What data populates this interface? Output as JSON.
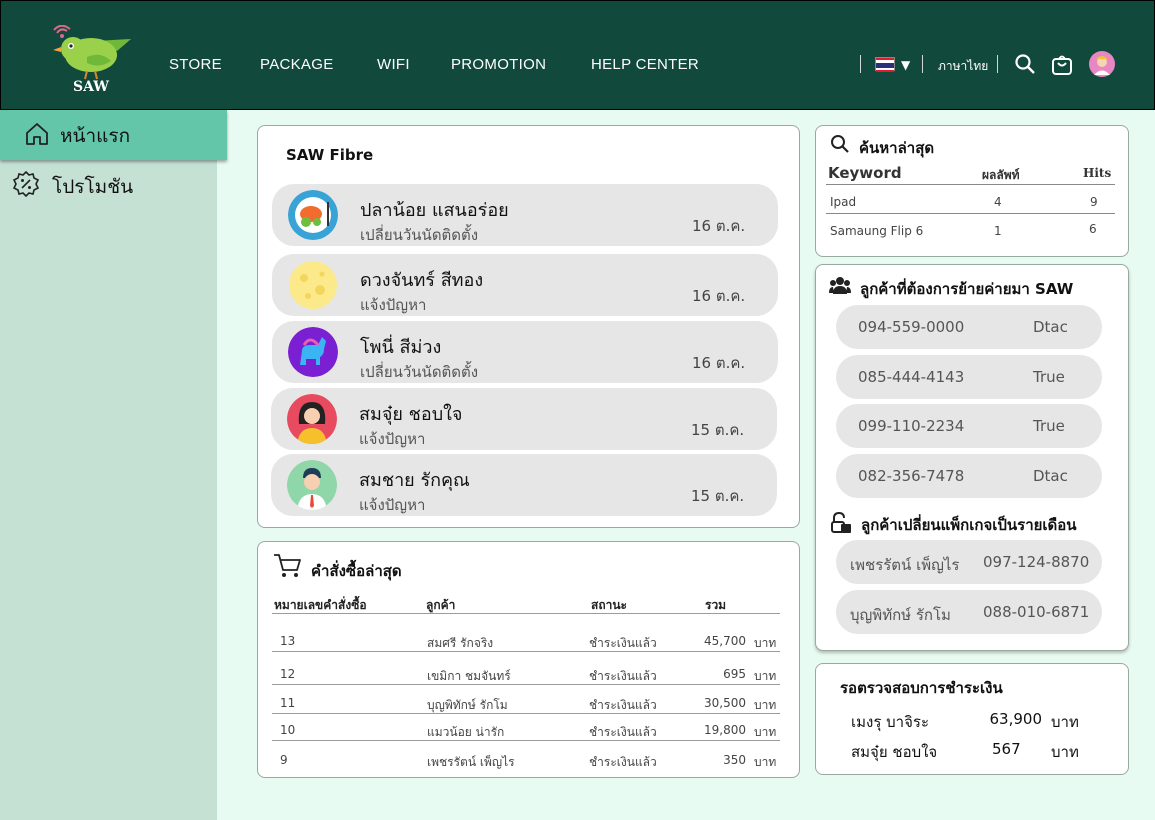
{
  "brand": {
    "name": "SAW"
  },
  "nav": [
    {
      "label": "STORE"
    },
    {
      "label": "PACKAGE"
    },
    {
      "label": "WIFI"
    },
    {
      "label": "PROMOTION"
    },
    {
      "label": "HELP CENTER"
    }
  ],
  "topbar": {
    "language": "ภาษาไทย",
    "icons": [
      "thailand-flag-icon",
      "search-icon",
      "cart-icon",
      "user-avatar"
    ]
  },
  "sidebar": {
    "items": [
      {
        "label": "หน้าแรก",
        "icon": "home-icon",
        "active": true
      },
      {
        "label": "โปรโมชัน",
        "icon": "discount-badge-icon",
        "active": false
      }
    ]
  },
  "colors": {
    "header": "#114a3d",
    "sidebar": "#c5e1d4",
    "sidebar_active": "#63c6a8",
    "background": "#e8fbf2",
    "pill": "#e6e6e6"
  },
  "feed": {
    "title": "SAW Fibre",
    "items": [
      {
        "name": "ปลาน้อย แสนอร่อย",
        "status": "เปลี่ยนวันนัดติดตั้ง",
        "date": "16 ต.ค.",
        "avatar": "food-plate-avatar"
      },
      {
        "name": "ดวงจันทร์ สีทอง",
        "status": "แจ้งปัญหา",
        "date": "16 ต.ค.",
        "avatar": "moon-avatar"
      },
      {
        "name": "โพนี่ สีม่วง",
        "status": "เปลี่ยนวันนัดติดตั้ง",
        "date": "16 ต.ค.",
        "avatar": "pony-avatar"
      },
      {
        "name": "สมจุ๋ย ชอบใจ",
        "status": "แจ้งปัญหา",
        "date": "15 ต.ค.",
        "avatar": "woman-avatar"
      },
      {
        "name": "สมชาย รักคุณ",
        "status": "แจ้งปัญหา",
        "date": "15 ต.ค.",
        "avatar": "man-avatar"
      }
    ]
  },
  "orders": {
    "title": "คำสั่งซื้อล่าสุด",
    "headers": {
      "id": "หมายเลขคำสั่งซื้อ",
      "customer": "ลูกค้า",
      "status": "สถานะ",
      "total": "รวม"
    },
    "currency": "บาท",
    "rows": [
      {
        "id": "13",
        "customer": "สมศรี รักจริง",
        "status": "ชำระเงินแล้ว",
        "total": "45,700"
      },
      {
        "id": "12",
        "customer": "เขมิกา ชมจันทร์",
        "status": "ชำระเงินแล้ว",
        "total": "695"
      },
      {
        "id": "11",
        "customer": "บุญพิทักษ์ รักโม",
        "status": "ชำระเงินแล้ว",
        "total": "30,500"
      },
      {
        "id": "10",
        "customer": "แมวน้อย น่ารัก",
        "status": "ชำระเงินแล้ว",
        "total": "19,800"
      },
      {
        "id": "9",
        "customer": "เพชรรัตน์ เพ็ญไร",
        "status": "ชำระเงินแล้ว",
        "total": "350"
      }
    ]
  },
  "search": {
    "title": "ค้นหาล่าสุด",
    "headers": {
      "keyword": "Keyword",
      "results": "ผลลัพท์",
      "hits": "Hits"
    },
    "rows": [
      {
        "keyword": "Ipad",
        "results": "4",
        "hits": "9"
      },
      {
        "keyword": "Samaung Flip 6",
        "results": "1",
        "hits": "6"
      }
    ]
  },
  "migrate": {
    "title": "ลูกค้าที่ต้องการย้ายค่ายมา SAW",
    "items": [
      {
        "phone": "094-559-0000",
        "carrier": "Dtac"
      },
      {
        "phone": "085-444-4143",
        "carrier": "True"
      },
      {
        "phone": "099-110-2234",
        "carrier": "True"
      },
      {
        "phone": "082-356-7478",
        "carrier": "Dtac"
      }
    ]
  },
  "monthly": {
    "title": "ลูกค้าเปลี่ยนแพ็กเกจเป็นรายเดือน",
    "items": [
      {
        "name": "เพชรรัตน์ เพ็ญไร",
        "phone": "097-124-8870"
      },
      {
        "name": "บุญพิทักษ์ รักโม",
        "phone": "088-010-6871"
      }
    ]
  },
  "payments": {
    "title": "รอตรวจสอบการชำระเงิน",
    "currency": "บาท",
    "items": [
      {
        "name": "เมงรุ บาจิระ",
        "amount": "63,900"
      },
      {
        "name": "สมจุ๋ย ชอบใจ",
        "amount": "567"
      }
    ]
  }
}
